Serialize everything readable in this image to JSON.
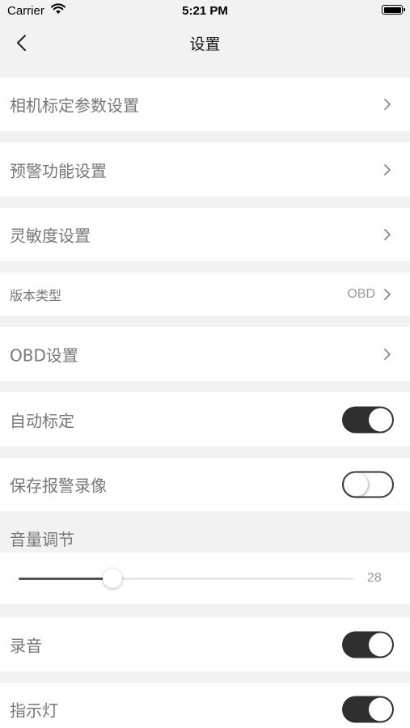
{
  "status_bar": {
    "carrier": "Carrier",
    "time": "5:21 PM"
  },
  "nav": {
    "title": "设置"
  },
  "rows": {
    "camera_calibration": "相机标定参数设置",
    "warning_settings": "预警功能设置",
    "sensitivity": "灵敏度设置",
    "version_type": "版本类型",
    "version_value": "OBD",
    "obd_settings": "OBD设置",
    "auto_calibration": "自动标定",
    "save_alarm_video": "保存报警录像",
    "recording": "录音",
    "indicator_light": "指示灯"
  },
  "toggles": {
    "auto_calibration": true,
    "save_alarm_video": false,
    "recording": true,
    "indicator_light": true
  },
  "volume": {
    "label": "音量调节",
    "value": "28",
    "level_fraction": 0.28
  }
}
